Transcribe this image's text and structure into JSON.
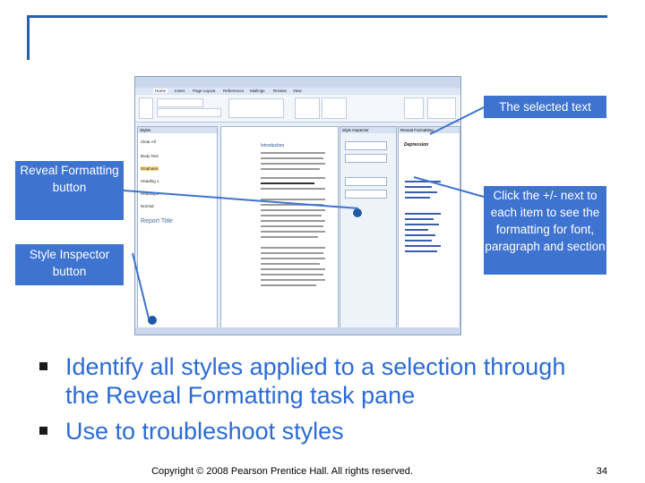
{
  "callouts": {
    "selected_text": "The selected text",
    "reveal_button": "Reveal Formatting button",
    "inspector_button": "Style Inspector button",
    "plus_minus": "Click the +/- next to each item to see the formatting for font, paragraph and section"
  },
  "screenshot": {
    "tabs": [
      "Home",
      "Insert",
      "Page Layout",
      "References",
      "Mailings",
      "Review",
      "View"
    ],
    "styles_pane_title": "Styles",
    "styles": [
      "Clear All",
      "Body Text",
      "Emphasis",
      "Heading 1",
      "Heading 2",
      "Normal",
      "Report Title"
    ],
    "doc_heading": "Introduction",
    "inspector_title": "Style Inspector",
    "reveal_title": "Reveal Formatting",
    "selected_label": "Depression"
  },
  "bullets": [
    "Identify all styles applied to a selection through the Reveal Formatting task pane",
    "Use to troubleshoot styles"
  ],
  "footer": {
    "copyright": "Copyright © 2008 Pearson Prentice Hall. All rights reserved.",
    "page_number": "34"
  },
  "colors": {
    "callout": "#3e73d0",
    "bullet_text": "#2b6bd6",
    "rule": "#2a5fb0"
  }
}
